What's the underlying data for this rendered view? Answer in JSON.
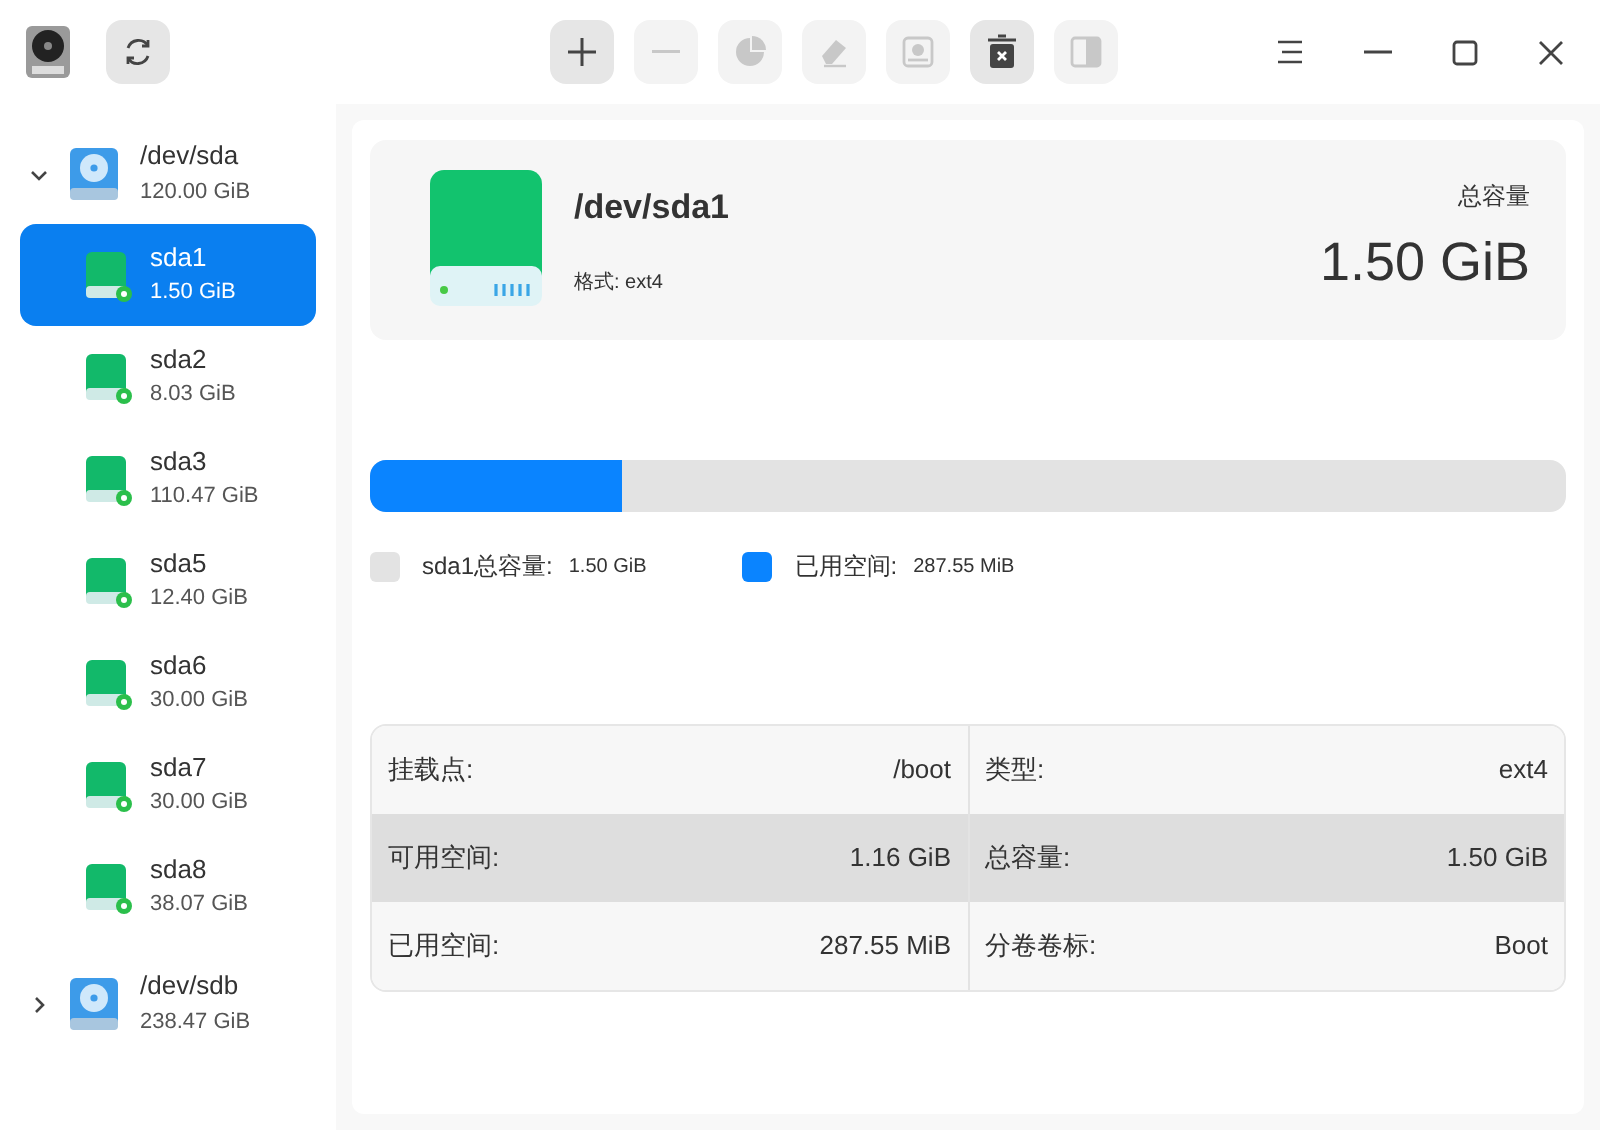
{
  "toolbar": [
    {
      "kind": "refresh",
      "disabled": false
    },
    {
      "kind": "add",
      "disabled": false
    },
    {
      "kind": "remove",
      "disabled": true
    },
    {
      "kind": "pie",
      "disabled": true
    },
    {
      "kind": "eraser",
      "disabled": true
    },
    {
      "kind": "disk",
      "disabled": true
    },
    {
      "kind": "delete",
      "disabled": false
    },
    {
      "kind": "split",
      "disabled": true
    }
  ],
  "sidebar": {
    "items": [
      {
        "name": "/dev/sda",
        "size": "120.00 GiB",
        "expanded": true,
        "children": [
          {
            "name": "sda1",
            "size": "1.50 GiB",
            "selected": true
          },
          {
            "name": "sda2",
            "size": "8.03 GiB",
            "selected": false
          },
          {
            "name": "sda3",
            "size": "110.47 GiB",
            "selected": false
          },
          {
            "name": "sda5",
            "size": "12.40 GiB",
            "selected": false
          },
          {
            "name": "sda6",
            "size": "30.00 GiB",
            "selected": false
          },
          {
            "name": "sda7",
            "size": "30.00 GiB",
            "selected": false
          },
          {
            "name": "sda8",
            "size": "38.07 GiB",
            "selected": false
          }
        ]
      },
      {
        "name": "/dev/sdb",
        "size": "238.47 GiB",
        "expanded": false
      }
    ]
  },
  "header": {
    "title": "/dev/sda1",
    "format": "格式: ext4",
    "capacity_label": "总容量",
    "capacity": "1.50 GiB"
  },
  "usage": {
    "level": 0.21,
    "legend": [
      {
        "label": "sda1总容量:",
        "value": "1.50 GiB",
        "color": "#e3e3e3"
      },
      {
        "label": "已用空间:",
        "value": "287.55 MiB",
        "color": "#0a84ff"
      }
    ]
  },
  "details": [
    [
      {
        "label": "挂载点:",
        "value": "/boot"
      },
      {
        "label": "类型:",
        "value": "ext4"
      }
    ],
    [
      {
        "label": "可用空间:",
        "value": "1.16 GiB"
      },
      {
        "label": "总容量:",
        "value": "1.50 GiB"
      }
    ],
    [
      {
        "label": "已用空间:",
        "value": "287.55 MiB"
      },
      {
        "label": "分卷卷标:",
        "value": "Boot"
      }
    ]
  ]
}
